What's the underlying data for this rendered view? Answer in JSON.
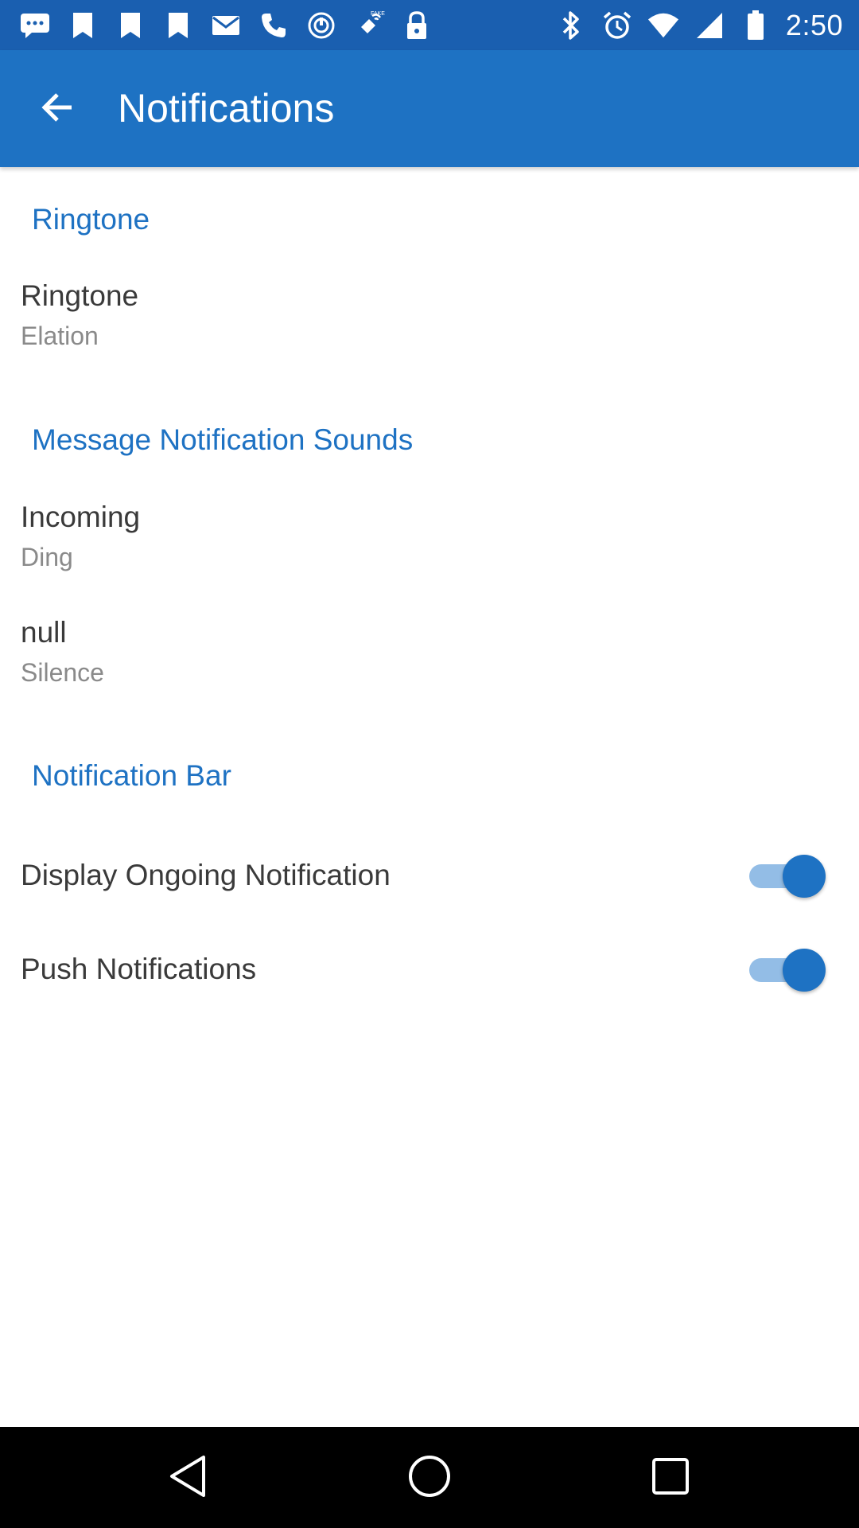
{
  "status_bar": {
    "time": "2:50",
    "left_icons": [
      "messages-icon",
      "bookmark-icon",
      "bookmark-icon",
      "bookmark-icon",
      "mail-icon",
      "phone-icon",
      "sync-icon",
      "fake-gps-icon",
      "lock-icon"
    ],
    "right_icons": [
      "bluetooth-icon",
      "alarm-icon",
      "wifi-icon",
      "signal-icon",
      "battery-icon"
    ]
  },
  "app_bar": {
    "title": "Notifications",
    "back_icon": "arrow-left-icon",
    "background": "#1e72c3"
  },
  "sections": {
    "ringtone": {
      "header": "Ringtone",
      "items": [
        {
          "title": "Ringtone",
          "summary": "Elation"
        }
      ]
    },
    "message_sounds": {
      "header": "Message Notification Sounds",
      "items": [
        {
          "title": "Incoming",
          "summary": "Ding"
        },
        {
          "title": "null",
          "summary": "Silence"
        }
      ]
    },
    "notification_bar": {
      "header": "Notification Bar",
      "items": [
        {
          "title": "Display Ongoing Notification",
          "checked": true
        },
        {
          "title": "Push Notifications",
          "checked": true
        }
      ]
    }
  },
  "colors": {
    "accent": "#1e72c3",
    "status_bar": "#1a5fb0",
    "switch_track_on": "#93bde6"
  },
  "nav_bar": {
    "icons": [
      "back-triangle-icon",
      "home-circle-icon",
      "recents-square-icon"
    ]
  }
}
